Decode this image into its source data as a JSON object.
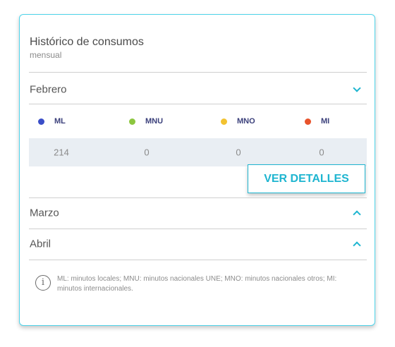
{
  "card": {
    "title": "Histórico de consumos",
    "subtitle": "mensual"
  },
  "months": [
    {
      "label": "Febrero",
      "expanded": true
    },
    {
      "label": "Marzo",
      "expanded": false
    },
    {
      "label": "Abril",
      "expanded": false
    }
  ],
  "legend": [
    {
      "label": "ML",
      "color": "#3a4ec8"
    },
    {
      "label": "MNU",
      "color": "#8cc63f"
    },
    {
      "label": "MNO",
      "color": "#f2c230"
    },
    {
      "label": "MI",
      "color": "#e8532b"
    }
  ],
  "values": [
    "214",
    "0",
    "0",
    "0"
  ],
  "details_button": "VER DETALLES",
  "footnote": "ML: minutos locales; MNU: minutos nacionales UNE; MNO: minutos nacionales otros; MI: minutos internacionales.",
  "icons": {
    "expanded": "chevron-down-icon",
    "collapsed": "chevron-up-icon",
    "info": "info-icon"
  }
}
